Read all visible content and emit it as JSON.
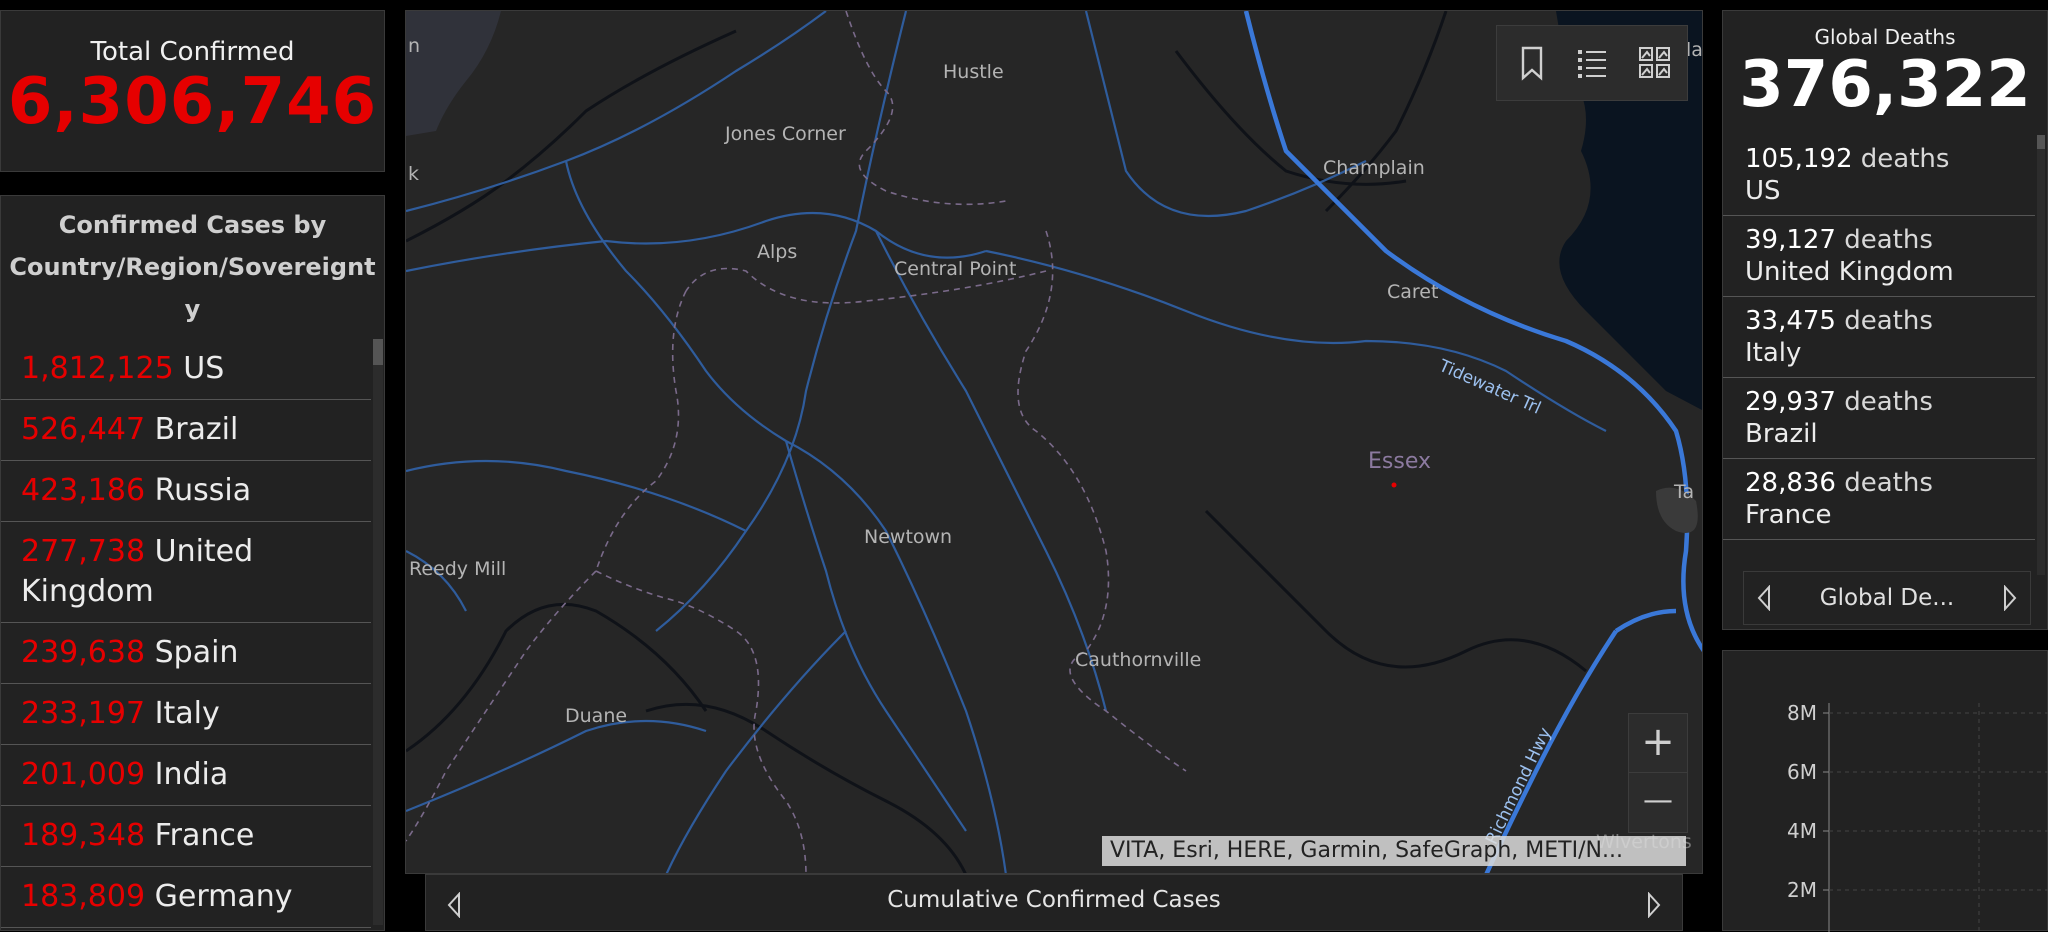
{
  "total_confirmed": {
    "label": "Total Confirmed",
    "value": "6,306,746"
  },
  "country_list": {
    "header": "Confirmed Cases by Country/Region/Sovereignt y",
    "rows": [
      {
        "count": "1,812,125",
        "name": "US"
      },
      {
        "count": "526,447",
        "name": "Brazil"
      },
      {
        "count": "423,186",
        "name": "Russia"
      },
      {
        "count": "277,738",
        "name": "United Kingdom"
      },
      {
        "count": "239,638",
        "name": "Spain"
      },
      {
        "count": "233,197",
        "name": "Italy"
      },
      {
        "count": "201,009",
        "name": "India"
      },
      {
        "count": "189,348",
        "name": "France"
      },
      {
        "count": "183,809",
        "name": "Germany"
      }
    ]
  },
  "map": {
    "labels": {
      "hustle": "Hustle",
      "jones_corner": "Jones Corner",
      "champlain": "Champlain",
      "alps": "Alps",
      "central_point": "Central Point",
      "caret": "Caret",
      "tidewater": "Tidewater Trl",
      "essex": "Essex",
      "newtown": "Newtown",
      "reedy_mill": "Reedy Mill",
      "cauthornville": "Cauthornville",
      "duane": "Duane",
      "richmond_hwy": "Richmond Hwy",
      "edge_n": "n",
      "edge_k": "k",
      "edge_ta": "Ta",
      "edge_la": "la",
      "edge_vertons": "Wlvertons"
    },
    "toolbar": {
      "bookmark": "bookmark-icon",
      "list": "list-icon",
      "basemap": "basemap-gallery-icon"
    },
    "zoom_in": "+",
    "zoom_out": "—",
    "attribution": "VITA, Esri, HERE, Garmin, SafeGraph, METI/N...",
    "tab_label": "Cumulative Confirmed Cases"
  },
  "global_deaths": {
    "label": "Global Deaths",
    "value": "376,322",
    "unit": "deaths",
    "rows": [
      {
        "count": "105,192",
        "name": "US"
      },
      {
        "count": "39,127",
        "name": "United Kingdom"
      },
      {
        "count": "33,475",
        "name": "Italy"
      },
      {
        "count": "29,937",
        "name": "Brazil"
      },
      {
        "count": "28,836",
        "name": "France"
      }
    ],
    "nav_label": "Global De..."
  },
  "chart_data": {
    "type": "line",
    "ylim": [
      0,
      8000000
    ],
    "y_ticks": [
      "8M",
      "6M",
      "4M",
      "2M"
    ],
    "grid": true
  },
  "colors": {
    "confirmed": "#e60000",
    "road": "#3a78d8",
    "water": "#0a1420",
    "land": "#262626"
  }
}
